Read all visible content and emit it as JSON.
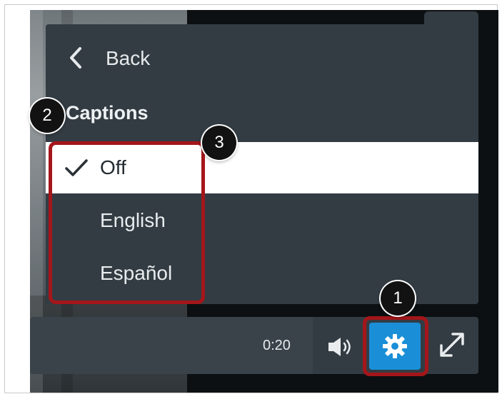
{
  "menu": {
    "back_label": "Back",
    "section_title": "Captions",
    "options": [
      {
        "label": "Off",
        "selected": true
      },
      {
        "label": "English",
        "selected": false
      },
      {
        "label": "Español",
        "selected": false
      }
    ]
  },
  "controls": {
    "time": "0:20",
    "icons": [
      "volume-icon",
      "settings-gear-icon",
      "fullscreen-icon"
    ]
  },
  "callouts": [
    "1",
    "2",
    "3"
  ],
  "colors": {
    "menu_bg": "#333c43",
    "selected_bg": "#ffffff",
    "settings_button": "#1a8fd8",
    "highlight": "#a4161a",
    "callout_bg": "#121212"
  }
}
